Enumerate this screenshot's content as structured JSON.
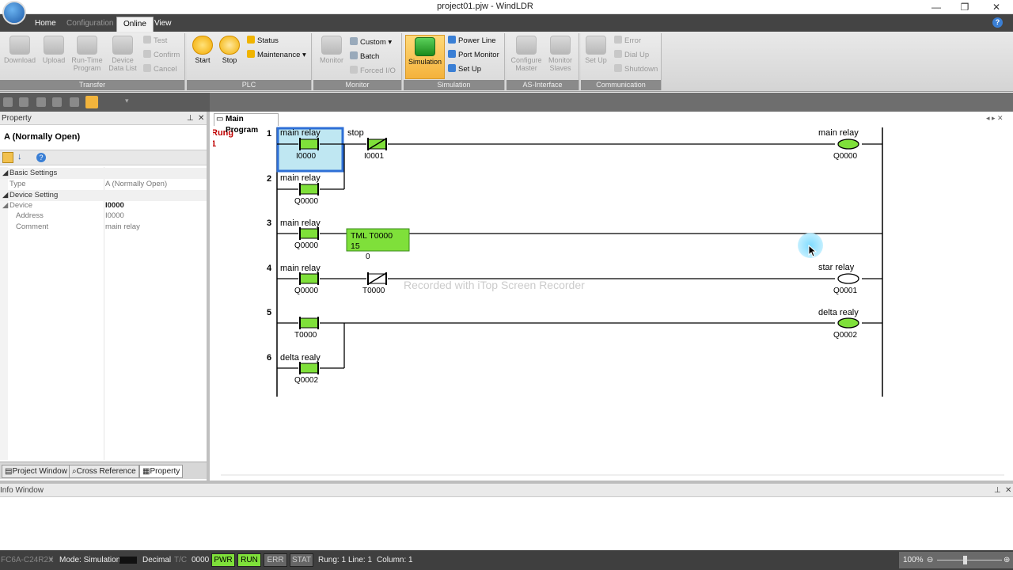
{
  "window": {
    "title": "project01.pjw - WindLDR"
  },
  "menu": {
    "tabs": [
      "Home",
      "Configuration",
      "Online",
      "View"
    ],
    "active": "Online"
  },
  "ribbon": {
    "transfer": {
      "label": "Transfer",
      "download": "Download",
      "upload": "Upload",
      "runtime1": "Run-Time",
      "runtime2": "Program",
      "datalist1": "Device",
      "datalist2": "Data List",
      "test": "Test",
      "confirm": "Confirm",
      "cancel": "Cancel"
    },
    "plc": {
      "label": "PLC",
      "start": "Start",
      "stop": "Stop",
      "status": "Status",
      "maintenance": "Maintenance"
    },
    "monitor": {
      "label": "Monitor",
      "monitor": "Monitor",
      "custom": "Custom",
      "batch": "Batch",
      "forced": "Forced I/O"
    },
    "simulation": {
      "label": "Simulation",
      "simulation": "Simulation",
      "powerline": "Power Line",
      "portmonitor": "Port Monitor",
      "setup": "Set Up"
    },
    "asi": {
      "label": "AS-Interface",
      "master1": "Configure",
      "master2": "Master",
      "slaves1": "Monitor",
      "slaves2": "Slaves"
    },
    "comm": {
      "label": "Communication",
      "setup": "Set Up",
      "error": "Error",
      "dialup": "Dial Up",
      "shutdown": "Shutdown"
    }
  },
  "property": {
    "header": "Property",
    "selected": "A (Normally Open)",
    "basic_settings": "Basic Settings",
    "type_key": "Type",
    "type_val": "A (Normally Open)",
    "device_setting": "Device Setting",
    "device_key": "Device",
    "device_val": "I0000",
    "address_key": "Address",
    "address_val": "I0000",
    "comment_key": "Comment",
    "comment_val": "main relay",
    "tabs": [
      "Project Window",
      "Cross Reference",
      "Property"
    ]
  },
  "editor": {
    "tab": "Main Program",
    "rung_label": "Rung",
    "rung_num": "1",
    "rungs": [
      "1",
      "2",
      "3",
      "4",
      "5",
      "6"
    ],
    "timer_text": "TML T0000",
    "timer_preset": "15",
    "timer_value": "0",
    "contacts": [
      {
        "comment": "main relay",
        "device": "I0000"
      },
      {
        "comment": "stop",
        "device": "I0001"
      },
      {
        "comment": "main relay",
        "device": "Q0000"
      },
      {
        "comment": "main relay",
        "device": "Q0000"
      },
      {
        "comment": "main relay",
        "device": "Q0000"
      },
      {
        "comment": "",
        "device": "T0000"
      },
      {
        "comment": "",
        "device": "T0000"
      },
      {
        "comment": "delta realy",
        "device": "Q0002"
      }
    ],
    "coils": [
      {
        "comment": "main relay",
        "device": "Q0000"
      },
      {
        "comment": "star relay",
        "device": "Q0001"
      },
      {
        "comment": "delta realy",
        "device": "Q0002"
      }
    ]
  },
  "watermark": "Recorded with iTop Screen Recorder",
  "info": {
    "header": "Info Window"
  },
  "status": {
    "plc": "FC6A-C24R2X",
    "mode": "Mode: Simulation",
    "number": "Decimal",
    "tc": "T/C",
    "value": "0000",
    "pwr": "PWR",
    "run": "RUN",
    "err": "ERR",
    "stat": "STAT",
    "rung": "Rung: 1",
    "line": "Line: 1",
    "column": "Column: 1",
    "zoom": "100%"
  },
  "colors": {
    "energized": "#7fe03a",
    "selection": "#2e6fd6",
    "rung_label": "#c00000"
  }
}
